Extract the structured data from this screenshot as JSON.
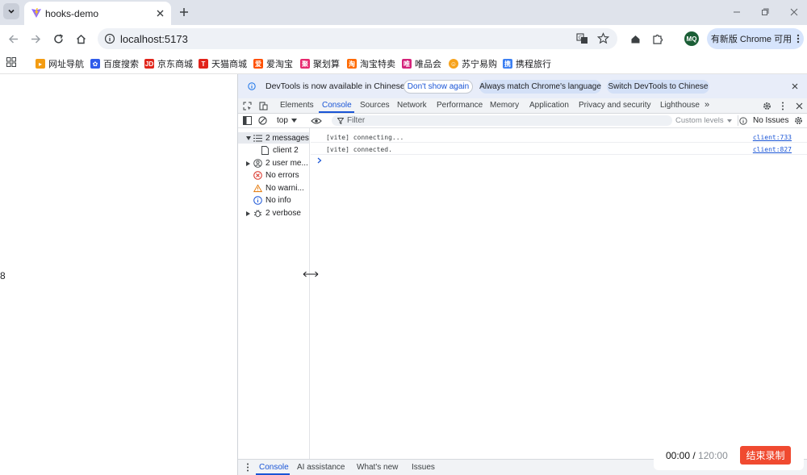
{
  "browser": {
    "tab_title": "hooks-demo",
    "url": "localhost:5173",
    "profile_initials": "MQ",
    "update_label": "有新版 Chrome 可用"
  },
  "bookmarks": [
    {
      "label": "网址导航",
      "color": "#f39c12"
    },
    {
      "label": "百度搜索",
      "color": "#2f5bea"
    },
    {
      "label": "京东商城",
      "color": "#e1251b"
    },
    {
      "label": "天猫商城",
      "color": "#e2231a"
    },
    {
      "label": "爱淘宝",
      "color": "#ff5000"
    },
    {
      "label": "聚划算",
      "color": "#e6286e"
    },
    {
      "label": "淘宝特卖",
      "color": "#ff6a00"
    },
    {
      "label": "唯品会",
      "color": "#d4237a"
    },
    {
      "label": "苏宁易购",
      "color": "#f7a21b"
    },
    {
      "label": "携程旅行",
      "color": "#3b7ff2"
    }
  ],
  "page": {
    "number_text": "8"
  },
  "devtools": {
    "infobar": {
      "message": "DevTools is now available in Chinese",
      "dont_show": "Don't show again",
      "always_match": "Always match Chrome's language",
      "switch": "Switch DevTools to Chinese"
    },
    "tabs": [
      "Elements",
      "Console",
      "Sources",
      "Network",
      "Performance",
      "Memory",
      "Application",
      "Privacy and security",
      "Lighthouse"
    ],
    "active_tab": "Console",
    "console_bar": {
      "context": "top",
      "filter_placeholder": "Filter",
      "levels": "Custom levels",
      "issues": "No Issues"
    },
    "sidebar": [
      {
        "label": "2 messages",
        "icon": "list-icon"
      },
      {
        "label": "client  2",
        "icon": "file-icon"
      },
      {
        "label": "2 user me...",
        "icon": "user-icon"
      },
      {
        "label": "No errors",
        "icon": "error-icon"
      },
      {
        "label": "No warni...",
        "icon": "warning-icon"
      },
      {
        "label": "No info",
        "icon": "info-icon"
      },
      {
        "label": "2 verbose",
        "icon": "bug-icon"
      }
    ],
    "logs": [
      {
        "message": "[vite] connecting...",
        "source": "client:733"
      },
      {
        "message": "[vite] connected.",
        "source": "client:827"
      }
    ],
    "drawer_tabs": [
      "Console",
      "AI assistance",
      "What's new",
      "Issues"
    ]
  },
  "recorder": {
    "elapsed": "00:00",
    "separator": " / ",
    "total": "120:00",
    "stop_label": "结束录制",
    "stop_color": "#f04a30"
  },
  "colors": {
    "accent": "#1a73e8",
    "tab_strip": "#dfe3eb",
    "infobar": "#e8edf9"
  }
}
